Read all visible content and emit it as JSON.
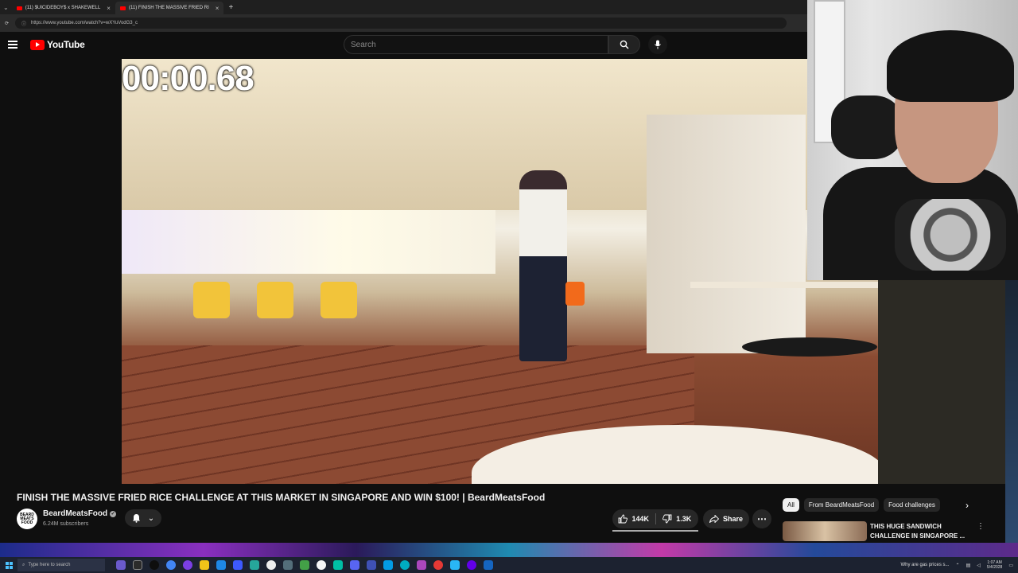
{
  "browser": {
    "tabs": [
      {
        "label": "(11) $UICIDEBOY$ x SHAKEWELL"
      },
      {
        "label": "(11) FINISH THE MASSIVE FRIED RI"
      }
    ],
    "url": "https://www.youtube.com/watch?v=wXYuVodG3_c"
  },
  "youtube": {
    "logo_text": "YouTube",
    "search_placeholder": "Search"
  },
  "video": {
    "timer": "00:00.68",
    "title": "FINISH THE MASSIVE FRIED RICE CHALLENGE AT THIS MARKET IN SINGAPORE AND WIN $100! | BeardMeatsFood"
  },
  "channel": {
    "name": "BeardMeatsFood",
    "subscribers": "6.24M subscribers",
    "avatar_text": "BEARD MEATS FOOD"
  },
  "actions": {
    "likes": "144K",
    "dislikes": "1.3K",
    "share": "Share"
  },
  "chips": [
    {
      "label": "All",
      "selected": true
    },
    {
      "label": "From BeardMeatsFood",
      "selected": false
    },
    {
      "label": "Food challenges",
      "selected": false
    }
  ],
  "recommendation": {
    "title": "THIS HUGE SANDWICH CHALLENGE IN SINGAPORE ..."
  },
  "taskbar": {
    "search_placeholder": "Type here to search",
    "news": "Why are gas prices s...",
    "time": "1:07 AM",
    "date": "5/4/2028"
  },
  "colors": {
    "brand_red": "#ff0000",
    "background": "#0f0f0f",
    "button_bg": "#272727"
  }
}
